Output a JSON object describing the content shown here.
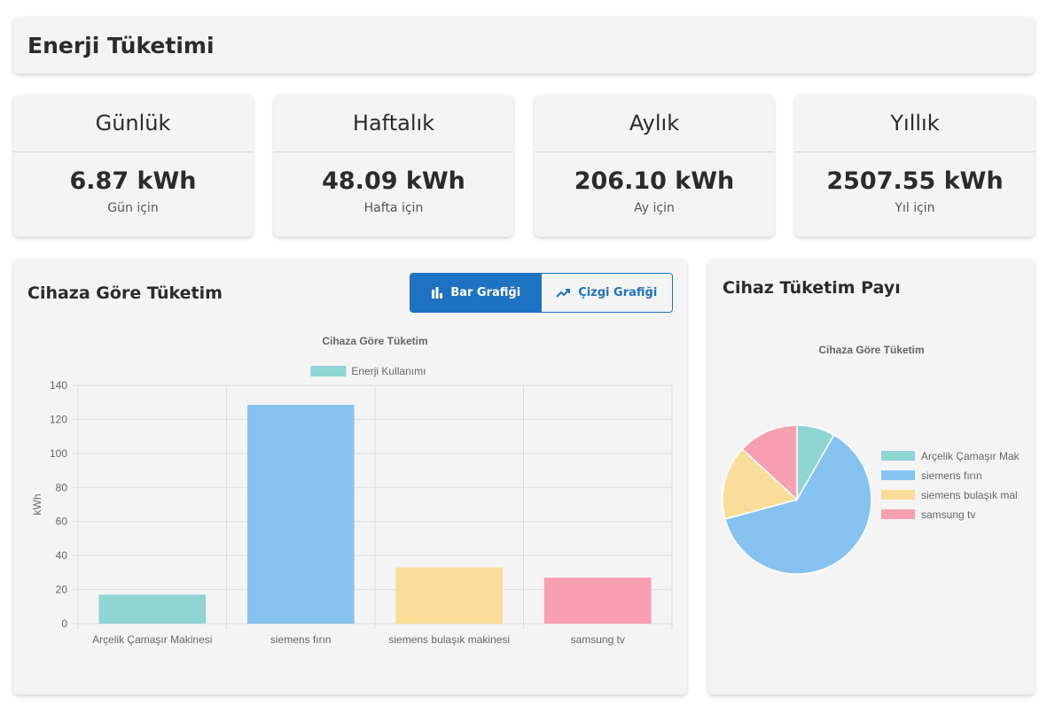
{
  "header": {
    "title": "Enerji Tüketimi"
  },
  "stats": [
    {
      "title": "Günlük",
      "value": "6.87 kWh",
      "sub": "Gün için"
    },
    {
      "title": "Haftalık",
      "value": "48.09 kWh",
      "sub": "Hafta için"
    },
    {
      "title": "Aylık",
      "value": "206.10 kWh",
      "sub": "Ay için"
    },
    {
      "title": "Yıllık",
      "value": "2507.55 kWh",
      "sub": "Yıl için"
    }
  ],
  "bar_card": {
    "title": "Cihaza Göre Tüketim",
    "toggle": {
      "bar_label": "Bar Grafiği",
      "line_label": "Çizgi Grafiği",
      "active": "bar",
      "bar_icon": "bar-chart-icon",
      "line_icon": "trending-up-icon"
    }
  },
  "pie_card": {
    "title": "Cihaz Tüketim Payı"
  },
  "chart_data": [
    {
      "type": "bar",
      "title": "Cihaza Göre Tüketim",
      "categories": [
        "Arçelik Çamaşır Makinesi",
        "siemens fırın",
        "siemens bulaşık makinesi",
        "samsung tv"
      ],
      "series": [
        {
          "name": "Enerji Kullanımı",
          "values": [
            17,
            128.5,
            33,
            27
          ]
        }
      ],
      "colors": [
        "#8ed5d4",
        "#85c2f0",
        "#f9dd98",
        "#f89fb2"
      ],
      "legend_color": "#8ed5d4",
      "xlabel": "",
      "ylabel": "kWh",
      "ylim": [
        0,
        140
      ],
      "yticks": [
        0,
        20,
        40,
        60,
        80,
        100,
        120,
        140
      ],
      "grid": true,
      "legend": "top"
    },
    {
      "type": "pie",
      "title": "Cihaza Göre Tüketim",
      "labels": [
        "Arçelik Çamaşır Makinesi",
        "siemens fırın",
        "siemens bulaşık makinesi",
        "samsung tv"
      ],
      "legend_labels": [
        "Arçelik Çamaşır Mak",
        "siemens fırın",
        "siemens bulaşık mal",
        "samsung tv"
      ],
      "values": [
        17,
        128.5,
        33,
        27
      ],
      "colors": [
        "#8ed5d4",
        "#85c2f0",
        "#f9dd98",
        "#f89fb2"
      ],
      "legend": "right"
    }
  ]
}
